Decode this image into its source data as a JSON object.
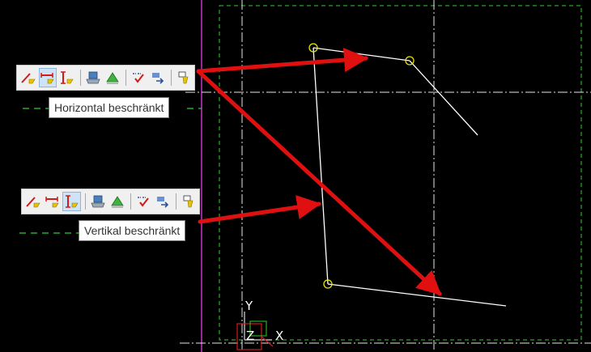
{
  "toolbar_horizontal": {
    "tooltip": "Horizontal beschränkt",
    "active_button": "horizontal-constraint-button"
  },
  "toolbar_vertical": {
    "tooltip": "Vertikal beschränkt",
    "active_button": "vertical-constraint-button"
  },
  "toolbar_icons": [
    "line-constraint-icon",
    "horizontal-constraint-icon",
    "vertical-constraint-icon",
    "layer-icon",
    "fill-icon",
    "check-icon",
    "redo-icon",
    "highlight-icon"
  ],
  "coordinate_system": {
    "y_label": "Y",
    "z_label": "Z",
    "x_label": "X"
  },
  "colors": {
    "background": "#000000",
    "sketch_line": "#ffffff",
    "constraint_point": "#e8e800",
    "annotation_arrow": "#e01010",
    "construction_line": "#32cd32",
    "origin_line": "#cc33cc"
  }
}
